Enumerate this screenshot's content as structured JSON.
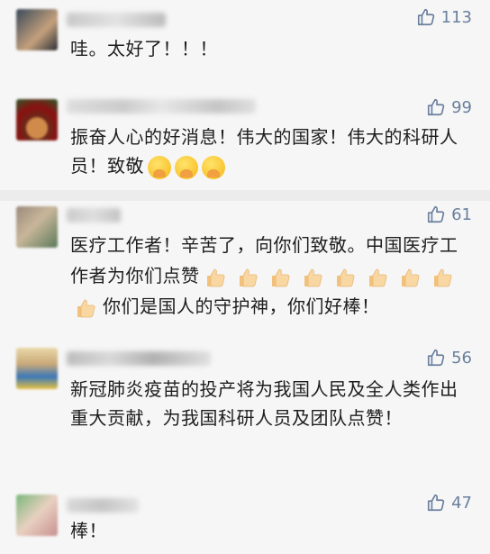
{
  "comments": [
    {
      "likes": "113",
      "text": "哇。太好了！！！"
    },
    {
      "likes": "99",
      "text": "振奋人心的好消息！伟大的国家！伟大的科研人员！致敬"
    },
    {
      "likes": "61",
      "text_part1": "医疗工作者！辛苦了，向你们致敬。中国医疗工作者为你们点赞",
      "text_part2": "你们是国人的守护神，你们好棒！"
    },
    {
      "likes": "56",
      "text": "新冠肺炎疫苗的投产将为我国人民及全人类作出重大贡献，为我国科研人员及团队点赞！"
    },
    {
      "likes": "47",
      "text": "棒！"
    }
  ],
  "icons": {
    "like": "thumbs-up-outline-icon",
    "think": "thinking-face-emoji",
    "thumb": "thumbs-up-emoji"
  },
  "colors": {
    "like": "#6a7f9e",
    "text": "#1e1e1e",
    "background": "#f6f6f6"
  }
}
